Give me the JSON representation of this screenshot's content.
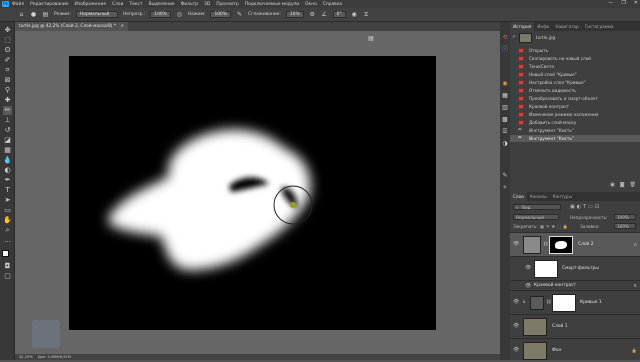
{
  "app": {
    "logo": "Ps",
    "window_controls": [
      "—",
      "❐",
      "✕"
    ]
  },
  "menu": [
    "Файл",
    "Редактирование",
    "Изображение",
    "Слои",
    "Текст",
    "Выделение",
    "Фильтр",
    "3D",
    "Просмотр",
    "Подключаемые модули",
    "Окно",
    "Справка"
  ],
  "options": {
    "mode_label": "Режим:",
    "mode_value": "Нормальный",
    "opacity_label": "Непрозр.:",
    "opacity_value": "100%",
    "flow_label": "Нажим:",
    "flow_value": "100%",
    "smoothing_label": "Сглаживание:",
    "smoothing_value": "10%",
    "angle_value": "0°"
  },
  "document": {
    "tab_title": "turtle.jpg @ 42,2% (Слой 2, Слой-маска/8) *",
    "close": "×"
  },
  "status": {
    "text": "42,19%",
    "doc_info": "Док: 3,09M/6,91M"
  },
  "history": {
    "tabs": [
      "История",
      "Инфо",
      "Навигатор",
      "Гистограмма"
    ],
    "snapshot": "turtle.jpg",
    "items": [
      "Открыть",
      "Скопировать на новый слой",
      "Тени/Света",
      "Новый слой \"Кривые\"",
      "Настройка слоя \"Кривые\"",
      "Отменить видимость",
      "Преобразовать в смарт-объект",
      "Краевой контраст",
      "Изменение режима наложения",
      "Добавить слой-маску",
      "Инструмент \"Кисть\"",
      "Инструмент \"Кисть\""
    ]
  },
  "layers": {
    "tabs": [
      "Слои",
      "Каналы",
      "Контуры"
    ],
    "kind_label": "Вид",
    "blend_mode": "Нормальный",
    "opacity_label": "Непрозрачность:",
    "opacity_value": "100%",
    "lock_label": "Закрепить:",
    "fill_label": "Заливка:",
    "fill_value": "100%",
    "rows": [
      {
        "name": "Слой 2"
      },
      {
        "name": "Смарт-фильтры"
      },
      {
        "name": "Краевой контраст"
      },
      {
        "name": "Кривые 1"
      },
      {
        "name": "Слой 1"
      },
      {
        "name": "Фон"
      }
    ]
  },
  "colors": {
    "accent": "#31a8ff",
    "history_icon": "#b24b4b"
  }
}
